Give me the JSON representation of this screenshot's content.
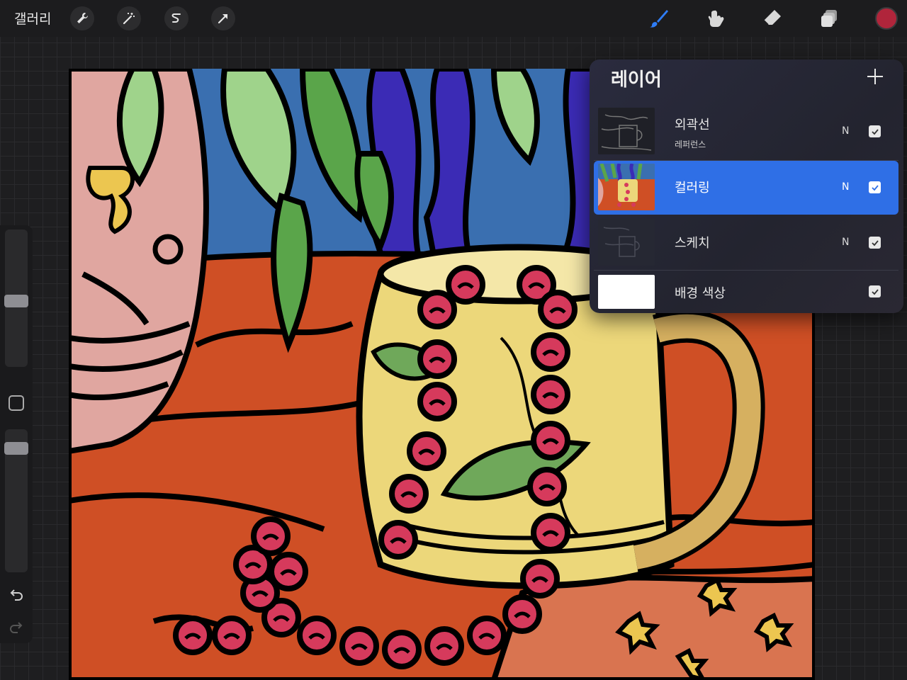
{
  "toolbar": {
    "gallery_label": "갤러리",
    "left_tools": [
      {
        "icon": "wrench-icon",
        "label": "actions"
      },
      {
        "icon": "magic-wand-icon",
        "label": "adjustments"
      },
      {
        "icon": "selection-icon",
        "label": "selection"
      },
      {
        "icon": "transform-arrow-icon",
        "label": "transform"
      }
    ],
    "right_tools": [
      {
        "icon": "brush-icon",
        "active": true
      },
      {
        "icon": "smudge-icon",
        "active": false
      },
      {
        "icon": "eraser-icon",
        "active": false
      },
      {
        "icon": "layers-icon",
        "active": false
      }
    ],
    "current_color": "#b0253b",
    "active_tool_color": "#2f7df6"
  },
  "sidebar": {
    "brush_size_level": 0.48,
    "opacity_level": 0.9
  },
  "layers_panel": {
    "title": "레이어",
    "layers": [
      {
        "name": "외곽선",
        "sub": "레퍼런스",
        "blend": "N",
        "visible": true,
        "selected": false
      },
      {
        "name": "컬러링",
        "sub": "",
        "blend": "N",
        "visible": true,
        "selected": true
      },
      {
        "name": "스케치",
        "sub": "",
        "blend": "N",
        "visible": true,
        "selected": false
      },
      {
        "name": "배경 색상",
        "sub": "",
        "blend": "",
        "visible": true,
        "selected": false
      }
    ],
    "selected_color": "#2f6fe6"
  },
  "artwork": {
    "palette": {
      "sky": "#3a6fb0",
      "table": "#cf4f25",
      "vase": "#e0a6a0",
      "mug": "#ecd77a",
      "beads": "#d63a5c",
      "leaf_light": "#9fd38b",
      "leaf_dark": "#5aa54a",
      "purple": "#3b2bb5"
    }
  }
}
